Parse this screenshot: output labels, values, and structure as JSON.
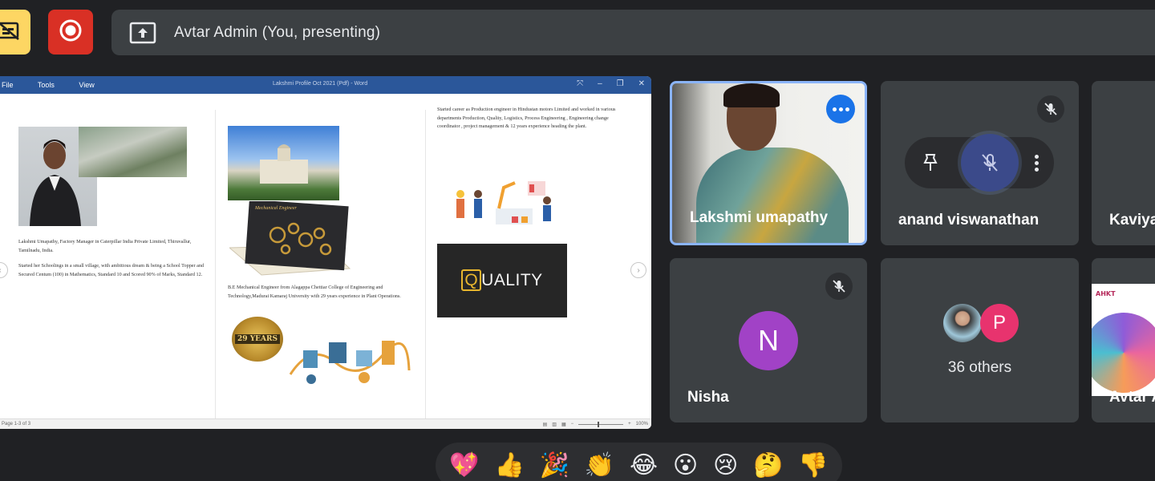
{
  "header": {
    "presenting_text": "Avtar Admin (You, presenting)"
  },
  "icons": {
    "captions": "captions-off-icon",
    "record": "record-icon",
    "present": "present-screen-icon"
  },
  "shared_document": {
    "menu": [
      "File",
      "Tools",
      "View"
    ],
    "title": "Lakshmi Profile Oct 2021 (Pdf) - Word",
    "column1_para1": "Lakshmi Umapathy, Factory Manager in Caterpillar India Private Limited, Thiruvallur, Tamilnadu, India.",
    "column1_para2": "Started her Schoolings in a small village, with ambitious dream & being a School Topper and Secured Centum (100) in Mathematics, Standard 10 and Scored 90% of Marks, Standard 12.",
    "column2_para1": "B.E Mechanical Engineer from Alagappa Chettiar College of Engineering and Technology,Madurai Kamaraj University with 29 years experience in Plant Operations.",
    "column3_para1": "Started career as Production engineer in Hindustan motors Limited and worked in various departments Production, Quality, Logistics, Process Engineering , Engineering change coordinator , project management & 12 years experience heading the plant.",
    "badge_text": "29 YEARS",
    "mech_card_text": "Mechanical Engineer",
    "quality_prefix": "Q",
    "quality_rest": "UALITY",
    "status_pages": "Page 1-3 of 3",
    "zoom": "100%"
  },
  "participants": {
    "lakshmi": {
      "name": "Lakshmi umapathy"
    },
    "anand": {
      "name": "anand viswanathan"
    },
    "kaviya": {
      "name": "Kaviya"
    },
    "nisha": {
      "name": "Nisha",
      "initial": "N",
      "avatar_color": "#a142c6"
    },
    "others": {
      "label": "36 others",
      "initial": "P",
      "avatar_color": "#e8336e"
    },
    "avtar": {
      "name": "Avtar A",
      "logo": "AHKT"
    }
  },
  "reactions": [
    "💖",
    "👍",
    "🎉",
    "👏",
    "😂",
    "😮",
    "😢",
    "🤔",
    "👎"
  ],
  "colors": {
    "background": "#202124",
    "tile": "#3c4043",
    "active_border": "#8ab4f8",
    "record": "#d93025",
    "captions": "#fdd663",
    "more_button": "#1a73e8"
  }
}
